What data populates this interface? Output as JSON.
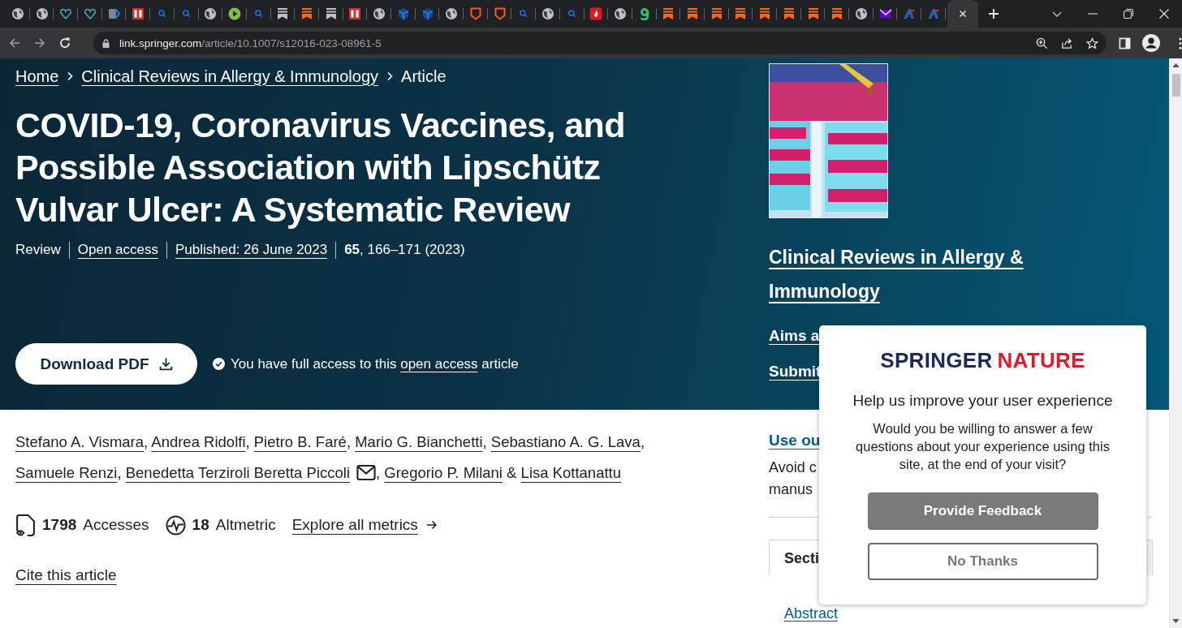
{
  "browser": {
    "tabs": [
      {
        "kind": "globe",
        "selected": false
      },
      {
        "kind": "globe",
        "selected": false
      },
      {
        "kind": "heart",
        "selected": false
      },
      {
        "kind": "heart",
        "selected": false
      },
      {
        "kind": "chevron",
        "selected": false
      },
      {
        "kind": "redsquare",
        "selected": false
      },
      {
        "kind": "search",
        "selected": false
      },
      {
        "kind": "search",
        "selected": false
      },
      {
        "kind": "globe",
        "selected": false
      },
      {
        "kind": "play",
        "selected": false
      },
      {
        "kind": "search",
        "selected": false
      },
      {
        "kind": "banner",
        "selected": false
      },
      {
        "kind": "orangebanner",
        "selected": false
      },
      {
        "kind": "banner",
        "selected": false
      },
      {
        "kind": "redsquare",
        "selected": false
      },
      {
        "kind": "globe",
        "selected": false
      },
      {
        "kind": "cube",
        "selected": false
      },
      {
        "kind": "cube",
        "selected": false
      },
      {
        "kind": "globe",
        "selected": false
      },
      {
        "kind": "shield",
        "selected": false
      },
      {
        "kind": "shield",
        "selected": false
      },
      {
        "kind": "search",
        "selected": false
      },
      {
        "kind": "globe",
        "selected": false
      },
      {
        "kind": "search",
        "selected": false
      },
      {
        "kind": "flame",
        "selected": false
      },
      {
        "kind": "globe",
        "selected": false
      },
      {
        "kind": "hook",
        "selected": false
      },
      {
        "kind": "orangebanner",
        "selected": false
      },
      {
        "kind": "orangebanner",
        "selected": false
      },
      {
        "kind": "orangebanner",
        "selected": false
      },
      {
        "kind": "orangebanner",
        "selected": false
      },
      {
        "kind": "orangebanner",
        "selected": false
      },
      {
        "kind": "orangebanner",
        "selected": false
      },
      {
        "kind": "orangebanner",
        "selected": false
      },
      {
        "kind": "orangebanner",
        "selected": false
      },
      {
        "kind": "globe",
        "selected": false
      },
      {
        "kind": "mail",
        "selected": false
      },
      {
        "kind": "triangle",
        "selected": false
      },
      {
        "kind": "triangle",
        "selected": false
      },
      {
        "kind": "blank",
        "selected": true
      }
    ],
    "url": {
      "host": "link.springer.com",
      "path": "/article/10.1007/s12016-023-08961-5"
    }
  },
  "breadcrumb": [
    {
      "label": "Home",
      "link": true
    },
    {
      "label": "Clinical Reviews in Allergy & Immunology",
      "link": true
    },
    {
      "label": "Article",
      "link": false
    }
  ],
  "article": {
    "title": "COVID-19, Coronavirus Vaccines, and Possible Association with Lipschütz Vulvar Ulcer: A Systematic Review",
    "meta": [
      {
        "text": "Review",
        "link": false
      },
      {
        "text": "Open access",
        "link": true
      },
      {
        "text": "Published: 26 June 2023",
        "link": true
      },
      {
        "text": "**65**, 166–171 (2023)",
        "link": false
      }
    ],
    "download_button": "Download PDF",
    "access_note": {
      "before": "You have full access to this",
      "link": "open access",
      "after": "article"
    }
  },
  "journal": {
    "name": "Clinical Reviews in Allergy & Immunology",
    "links": [
      "Aims a",
      "Submit"
    ]
  },
  "authors": [
    {
      "name": "Stefano A. Vismara",
      "mail": false,
      "sep": ", "
    },
    {
      "name": "Andrea Ridolfi",
      "mail": false,
      "sep": ", "
    },
    {
      "name": "Pietro B. Faré",
      "mail": false,
      "sep": ", "
    },
    {
      "name": "Mario G. Bianchetti",
      "mail": false,
      "sep": ", "
    },
    {
      "name": "Sebastiano A. G. Lava",
      "mail": false,
      "sep": ", "
    },
    {
      "name": "Samuele Renzi",
      "mail": false,
      "sep": ", "
    },
    {
      "name": "Benedetta Terziroli Beretta Piccoli",
      "mail": true,
      "sep": ", "
    },
    {
      "name": "Gregorio P. Milani",
      "mail": false,
      "sep": " & "
    },
    {
      "name": "Lisa Kottanattu",
      "mail": false
    }
  ],
  "metrics": [
    {
      "kind": "accesses",
      "value": "1798",
      "label": "Accesses"
    },
    {
      "kind": "altmetric",
      "value": "18",
      "label": "Altmetric"
    }
  ],
  "explore_link": "Explore all metrics",
  "cite_link": "Cite this article",
  "sidebar": {
    "link": "Use ou",
    "text_lines": [
      "Avoid c",
      "manus"
    ],
    "sections_tab": "Secti",
    "section_links": [
      "Abstract"
    ]
  },
  "popup": {
    "logo": [
      "SPRINGER",
      "NATURE"
    ],
    "heading": "Help us improve your user experience",
    "body": "Would you be willing to answer a few questions about your experience using this site, at the end of your visit?",
    "buttons": [
      {
        "label": "Provide Feedback",
        "kind": "primary"
      },
      {
        "label": "No Thanks",
        "kind": "secondary"
      }
    ]
  }
}
